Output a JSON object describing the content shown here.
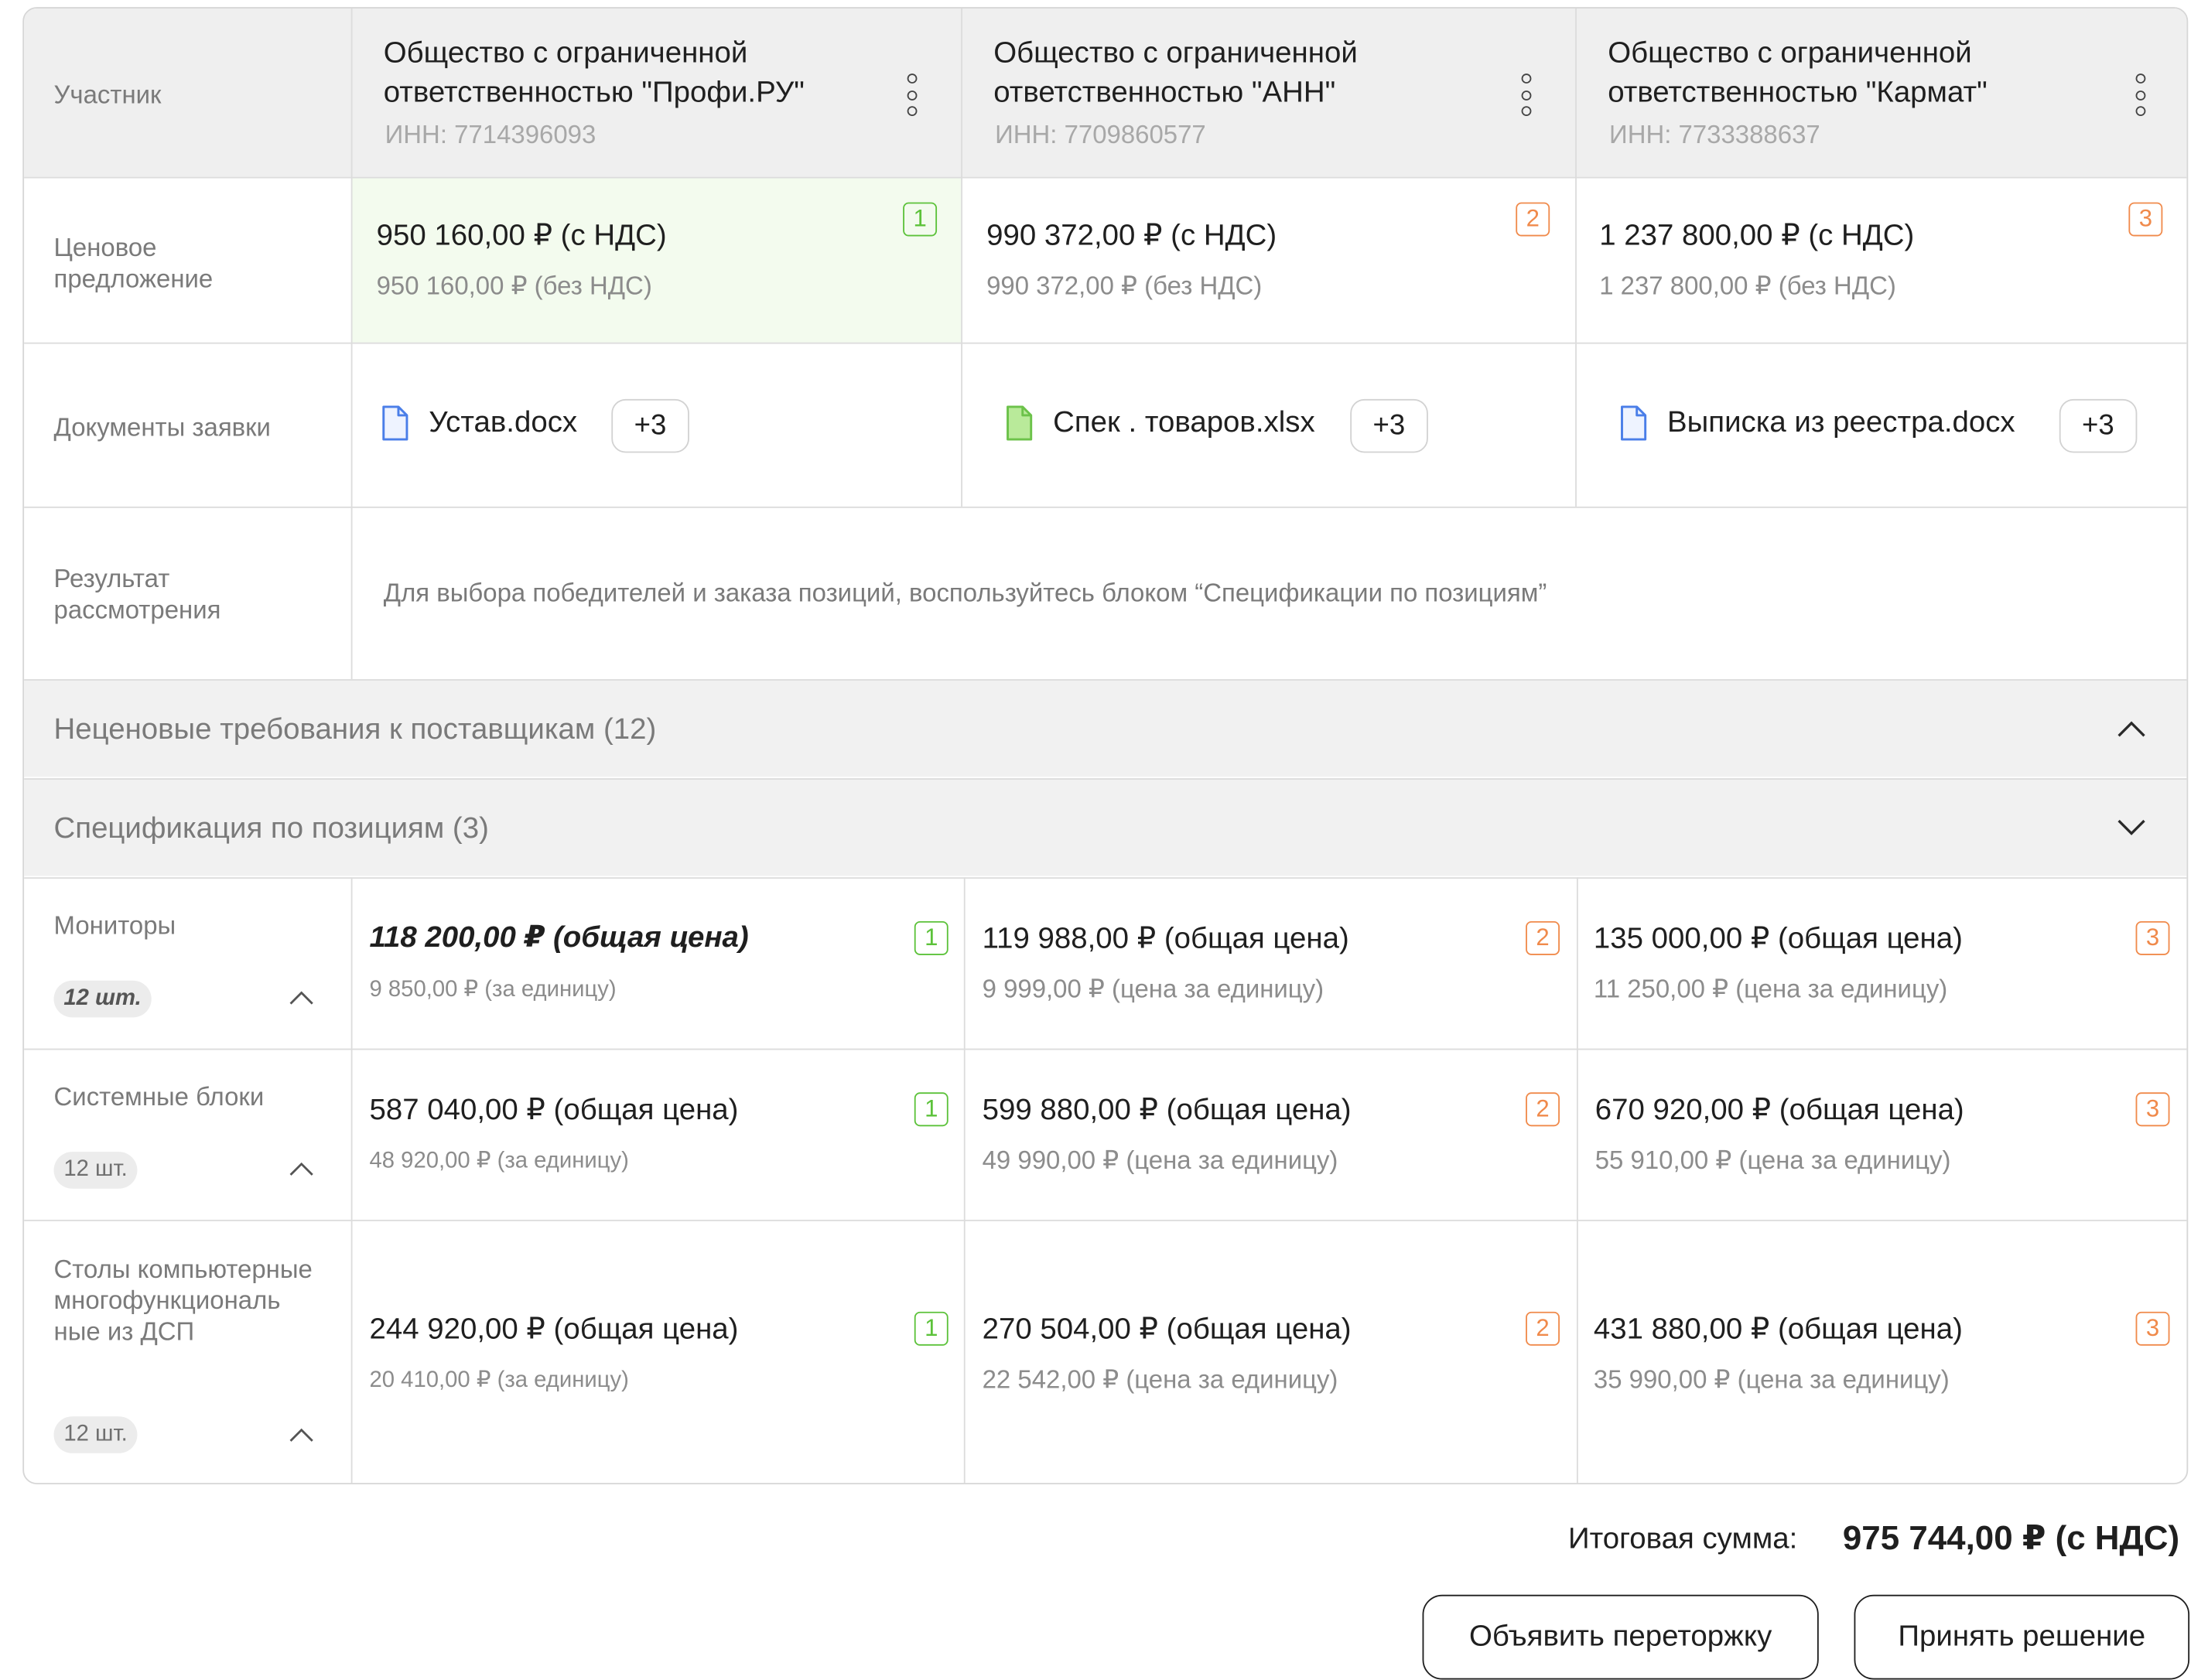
{
  "header": {
    "participant_label": "Участник"
  },
  "participants": [
    {
      "name": "Общество с ограниченной ответственностью \"Профи.РУ\"",
      "inn": "ИНН: 7714396093"
    },
    {
      "name": "Общество с ограниченной ответственностью \"АНН\"",
      "inn": "ИНН: 7709860577"
    },
    {
      "name": "Общество с ограниченной ответственностью \"Кармат\"",
      "inn": "ИНН: 7733388637"
    }
  ],
  "price_offer": {
    "label": "Ценовое предложение",
    "offers": [
      {
        "with_vat": "950 160,00 ₽ (с НДС)",
        "without_vat": "950 160,00 ₽ (без НДС)",
        "rank": "1"
      },
      {
        "with_vat": "990 372,00 ₽ (с НДС)",
        "without_vat": "990 372,00 ₽ (без НДС)",
        "rank": "2"
      },
      {
        "with_vat": "1 237 800,00 ₽ (с НДС)",
        "without_vat": "1 237 800,00 ₽ (без НДС)",
        "rank": "3"
      }
    ]
  },
  "documents": {
    "label": "Документы заявки",
    "items": [
      {
        "file": "Устав.docx",
        "more": "+3"
      },
      {
        "file": "Спек . товаров.xlsx",
        "more": "+3"
      },
      {
        "file": "Выписка из реестра.docx",
        "more": "+3"
      }
    ]
  },
  "result": {
    "label": "Результат рассмотрения",
    "note": "Для выбора победителей и заказа позиций, воспользуйтесь блоком “Спецификации по позициям”"
  },
  "non_price": {
    "title": "Неценовые требования к поставщикам (12)"
  },
  "specification": {
    "title": "Спецификация по позициям (3)"
  },
  "positions": [
    {
      "name": "Мониторы",
      "qty": "12 шт.",
      "offers": [
        {
          "total": "118 200,00 ₽ (общая цена)",
          "unit": "9 850,00 ₽ (за единицу)",
          "rank": "1"
        },
        {
          "total": "119 988,00 ₽ (общая цена)",
          "unit": "9 999,00 ₽ (цена за единицу)",
          "rank": "2"
        },
        {
          "total": "135 000,00 ₽ (общая цена)",
          "unit": "11 250,00 ₽ (цена за единицу)",
          "rank": "3"
        }
      ]
    },
    {
      "name": "Системные блоки",
      "qty": "12 шт.",
      "offers": [
        {
          "total": "587 040,00 ₽ (общая цена)",
          "unit": "48 920,00 ₽ (за единицу)",
          "rank": "1"
        },
        {
          "total": "599 880,00 ₽ (общая цена)",
          "unit": "49 990,00 ₽ (цена за единицу)",
          "rank": "2"
        },
        {
          "total": "670 920,00 ₽ (общая цена)",
          "unit": "55 910,00 ₽ (цена за единицу)",
          "rank": "3"
        }
      ]
    },
    {
      "name": "Столы компьютерные многофункциональ ные из ДСП",
      "qty": "12 шт.",
      "offers": [
        {
          "total": "244 920,00 ₽ (общая цена)",
          "unit": "20 410,00 ₽ (за единицу)",
          "rank": "1"
        },
        {
          "total": "270 504,00 ₽ (общая цена)",
          "unit": "22 542,00 ₽ (цена за единицу)",
          "rank": "2"
        },
        {
          "total": "431 880,00 ₽ (общая цена)",
          "unit": "35 990,00 ₽ (цена за единицу)",
          "rank": "3"
        }
      ]
    }
  ],
  "total": {
    "label": "Итоговая сумма:",
    "value": "975 744,00 ₽ (с НДС)"
  },
  "actions": {
    "rebid": "Объявить переторжку",
    "decide": "Принять решение"
  },
  "colors": {
    "winner_bg": "#f3fbee",
    "rank_first": "#5cc23a",
    "rank_other": "#f08a4b",
    "doc_word": "#4a7ee8",
    "doc_excel": "#6cc24a"
  }
}
